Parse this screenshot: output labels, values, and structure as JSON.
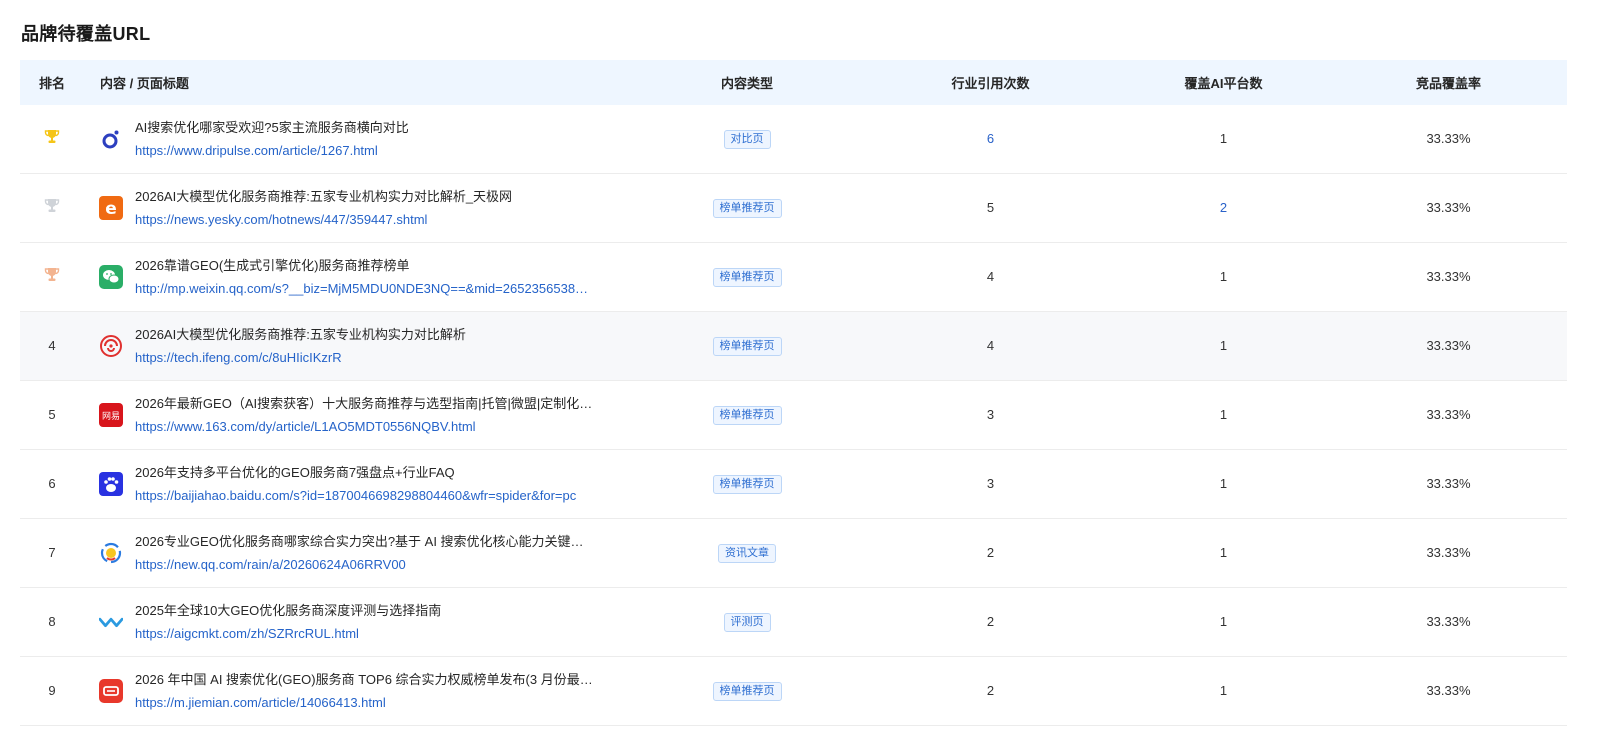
{
  "title": "品牌待覆盖URL",
  "columns": {
    "rank": "排名",
    "content": "内容 / 页面标题",
    "type": "内容类型",
    "citations": "行业引用次数",
    "platforms": "覆盖AI平台数",
    "rate": "竞品覆盖率"
  },
  "colors": {
    "gold": "#f5c518",
    "silver": "#cfd3d8",
    "bronze": "#f3b490",
    "link": "#2563c9",
    "header_bg": "#eef6ff"
  },
  "rows": [
    {
      "rank": "1",
      "rank_icon": "trophy-gold-icon",
      "site_icon": "dripulse-icon",
      "title": "AI搜索优化哪家受欢迎?5家主流服务商横向对比",
      "url": "https://www.dripulse.com/article/1267.html",
      "type": "对比页",
      "citations": "6",
      "platforms": "1",
      "rate": "33.33%"
    },
    {
      "rank": "2",
      "rank_icon": "trophy-silver-icon",
      "site_icon": "yesky-icon",
      "title": "2026AI大模型优化服务商推荐:五家专业机构实力对比解析_天极网",
      "url": "https://news.yesky.com/hotnews/447/359447.shtml",
      "type": "榜单推荐页",
      "citations": "5",
      "platforms": "2",
      "rate": "33.33%"
    },
    {
      "rank": "3",
      "rank_icon": "trophy-bronze-icon",
      "site_icon": "wechat-icon",
      "title": "2026靠谱GEO(生成式引擎优化)服务商推荐榜单",
      "url": "http://mp.weixin.qq.com/s?__biz=MjM5MDU0NDE3NQ==&mid=2652356538…",
      "type": "榜单推荐页",
      "citations": "4",
      "platforms": "1",
      "rate": "33.33%"
    },
    {
      "rank": "4",
      "site_icon": "ifeng-icon",
      "title": "2026AI大模型优化服务商推荐:五家专业机构实力对比解析",
      "url": "https://tech.ifeng.com/c/8uHIicIKzrR",
      "type": "榜单推荐页",
      "citations": "4",
      "platforms": "1",
      "rate": "33.33%"
    },
    {
      "rank": "5",
      "site_icon": "netease-icon",
      "title": "2026年最新GEO（AI搜索获客）十大服务商推荐与选型指南|托管|微盟|定制化…",
      "url": "https://www.163.com/dy/article/L1AO5MDT0556NQBV.html",
      "type": "榜单推荐页",
      "citations": "3",
      "platforms": "1",
      "rate": "33.33%"
    },
    {
      "rank": "6",
      "site_icon": "baidu-paw-icon",
      "title": "2026年支持多平台优化的GEO服务商7强盘点+行业FAQ",
      "url": "https://baijiahao.baidu.com/s?id=1870046698298804460&wfr=spider&for=pc",
      "type": "榜单推荐页",
      "citations": "3",
      "platforms": "1",
      "rate": "33.33%"
    },
    {
      "rank": "7",
      "site_icon": "tencent-news-icon",
      "title": "2026专业GEO优化服务商哪家综合实力突出?基于 AI 搜索优化核心能力关键…",
      "url": "https://new.qq.com/rain/a/20260624A06RRV00",
      "type": "资讯文章",
      "citations": "2",
      "platforms": "1",
      "rate": "33.33%"
    },
    {
      "rank": "8",
      "site_icon": "aigcmkt-wave-icon",
      "title": "2025年全球10大GEO优化服务商深度评测与选择指南",
      "url": "https://aigcmkt.com/zh/SZRrcRUL.html",
      "type": "评测页",
      "citations": "2",
      "platforms": "1",
      "rate": "33.33%"
    },
    {
      "rank": "9",
      "site_icon": "jiemian-icon",
      "title": "2026 年中国 AI 搜索优化(GEO)服务商 TOP6 综合实力权威榜单发布(3 月份最…",
      "url": "https://m.jiemian.com/article/14066413.html",
      "type": "榜单推荐页",
      "citations": "2",
      "platforms": "1",
      "rate": "33.33%"
    }
  ]
}
